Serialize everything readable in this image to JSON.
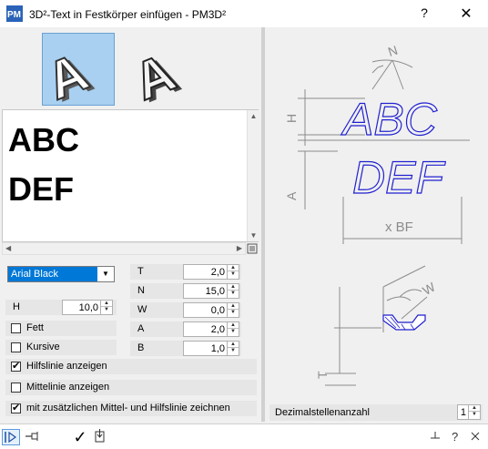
{
  "window": {
    "title": "3D²-Text in Festkörper einfügen   -   PM3D²",
    "icon_text": "PM",
    "help_label": "?",
    "close_label": "✕"
  },
  "thumbnails": {
    "letters": [
      "A",
      "A"
    ]
  },
  "preview": {
    "line1": "ABC",
    "line2": "DEF"
  },
  "font": {
    "selected": "Arial Black"
  },
  "left_params": {
    "h_label": "H",
    "h_value": "10,0"
  },
  "right_params": [
    {
      "label": "T",
      "value": "2,0"
    },
    {
      "label": "N",
      "value": "15,0"
    },
    {
      "label": "W",
      "value": "0,0"
    },
    {
      "label": "A",
      "value": "2,0"
    },
    {
      "label": "B",
      "value": "1,0"
    }
  ],
  "checkboxes": {
    "fett": {
      "label": "Fett",
      "checked": false
    },
    "kursive": {
      "label": "Kursive",
      "checked": false
    },
    "hilfslinie": {
      "label": "Hilfslinie anzeigen",
      "checked": true
    },
    "mittellinie": {
      "label": "Mittelinie anzeigen",
      "checked": false
    },
    "zusaetzlich": {
      "label": "mit zusätzlichen Mittel- und Hilfslinie zeichnen",
      "checked": true
    }
  },
  "diagram": {
    "text_line1": "ABC",
    "text_line2": "DEF",
    "label_n": "N",
    "label_h": "H",
    "label_a": "A",
    "label_bf": "x BF",
    "label_w": "W",
    "label_t": "T"
  },
  "decimal": {
    "label": "Dezimalstellenanzahl",
    "value": "1"
  },
  "bottombar": {
    "ok_label": "✓"
  },
  "colors": {
    "selection_blue": "#0078d7",
    "diagram_text_blue": "#1f1fd0",
    "diagram_line": "#8c8c8c"
  }
}
